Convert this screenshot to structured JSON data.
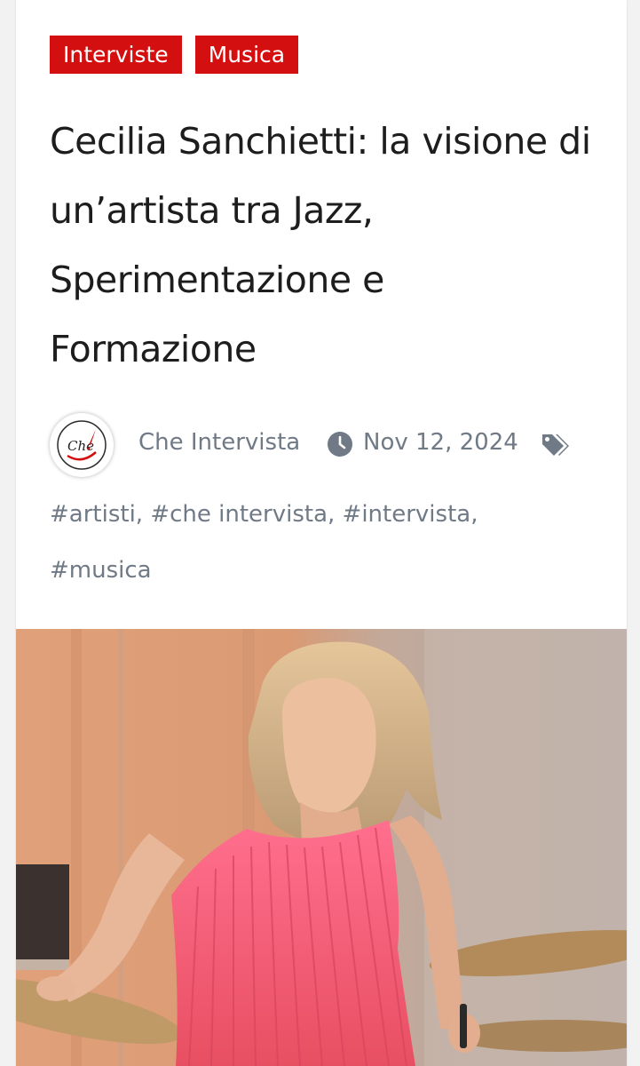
{
  "categories": [
    {
      "label": "Interviste"
    },
    {
      "label": "Musica"
    }
  ],
  "article": {
    "title": "Cecilia Sanchietti: la visione di un’artista tra Jazz, Sperimentazione e Formazione"
  },
  "meta": {
    "author": "Che Intervista",
    "avatar_text": "Che",
    "date": "Nov 12, 2024"
  },
  "tags": [
    "#artisti",
    "#che intervista",
    "#intervista",
    "#musica"
  ],
  "tag_separator": ", ",
  "colors": {
    "category_bg": "#d40f0f",
    "meta_text": "#6f7a86",
    "title_text": "#1d1d1d"
  },
  "icons": [
    "clock-icon",
    "tags-icon",
    "quill-icon"
  ]
}
